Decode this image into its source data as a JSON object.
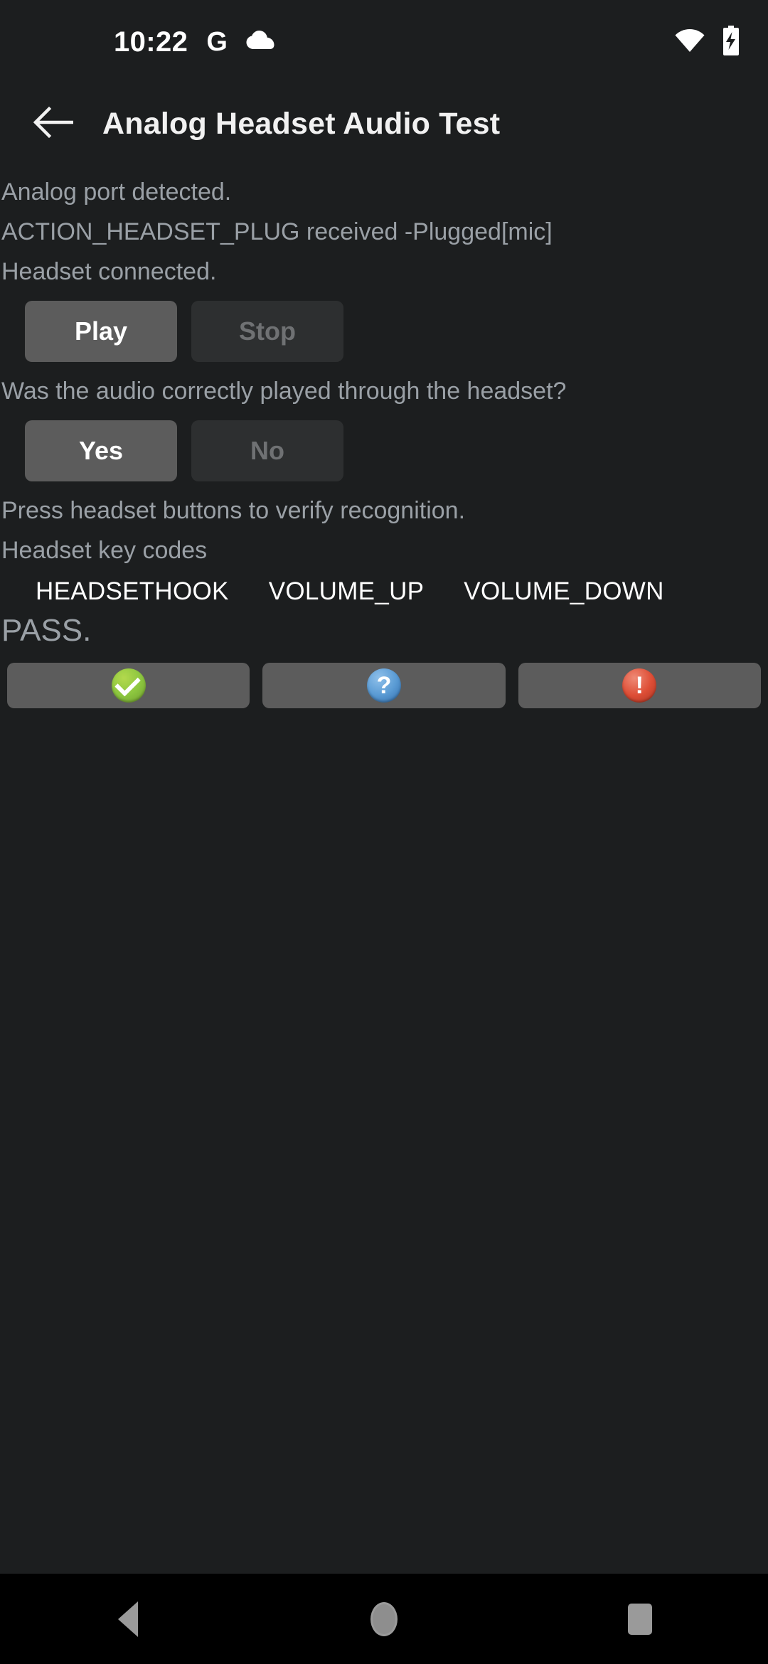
{
  "status_bar": {
    "clock": "10:22",
    "google_icon": "G",
    "icons": [
      "google-icon",
      "cloud-icon",
      "wifi-icon",
      "battery-charging-icon"
    ]
  },
  "app_bar": {
    "back_icon": "arrow-left-icon",
    "title": "Analog Headset Audio Test"
  },
  "content": {
    "status_lines": [
      "Analog port detected.",
      "ACTION_HEADSET_PLUG received -Plugged[mic]",
      "Headset connected."
    ],
    "playback": {
      "play_label": "Play",
      "stop_label": "Stop"
    },
    "audio_question": "Was the audio correctly played through the headset?",
    "answer": {
      "yes_label": "Yes",
      "no_label": "No"
    },
    "press_instruction": "Press headset buttons to verify recognition.",
    "keycodes_label": "Headset key codes",
    "keycodes": [
      "HEADSETHOOK",
      "VOLUME_UP",
      "VOLUME_DOWN"
    ],
    "result_text": "PASS."
  },
  "verdict_buttons": [
    {
      "name": "pass-button",
      "icon": "check-circle-icon",
      "glyph": "",
      "color": "#8cc63f"
    },
    {
      "name": "info-button",
      "icon": "question-circle-icon",
      "glyph": "?",
      "color": "#5a9bd4"
    },
    {
      "name": "fail-button",
      "icon": "exclamation-circle-icon",
      "glyph": "!",
      "color": "#de4e36"
    }
  ],
  "nav_bar": {
    "back": "nav-back-icon",
    "home": "nav-home-icon",
    "recents": "nav-recents-icon"
  }
}
